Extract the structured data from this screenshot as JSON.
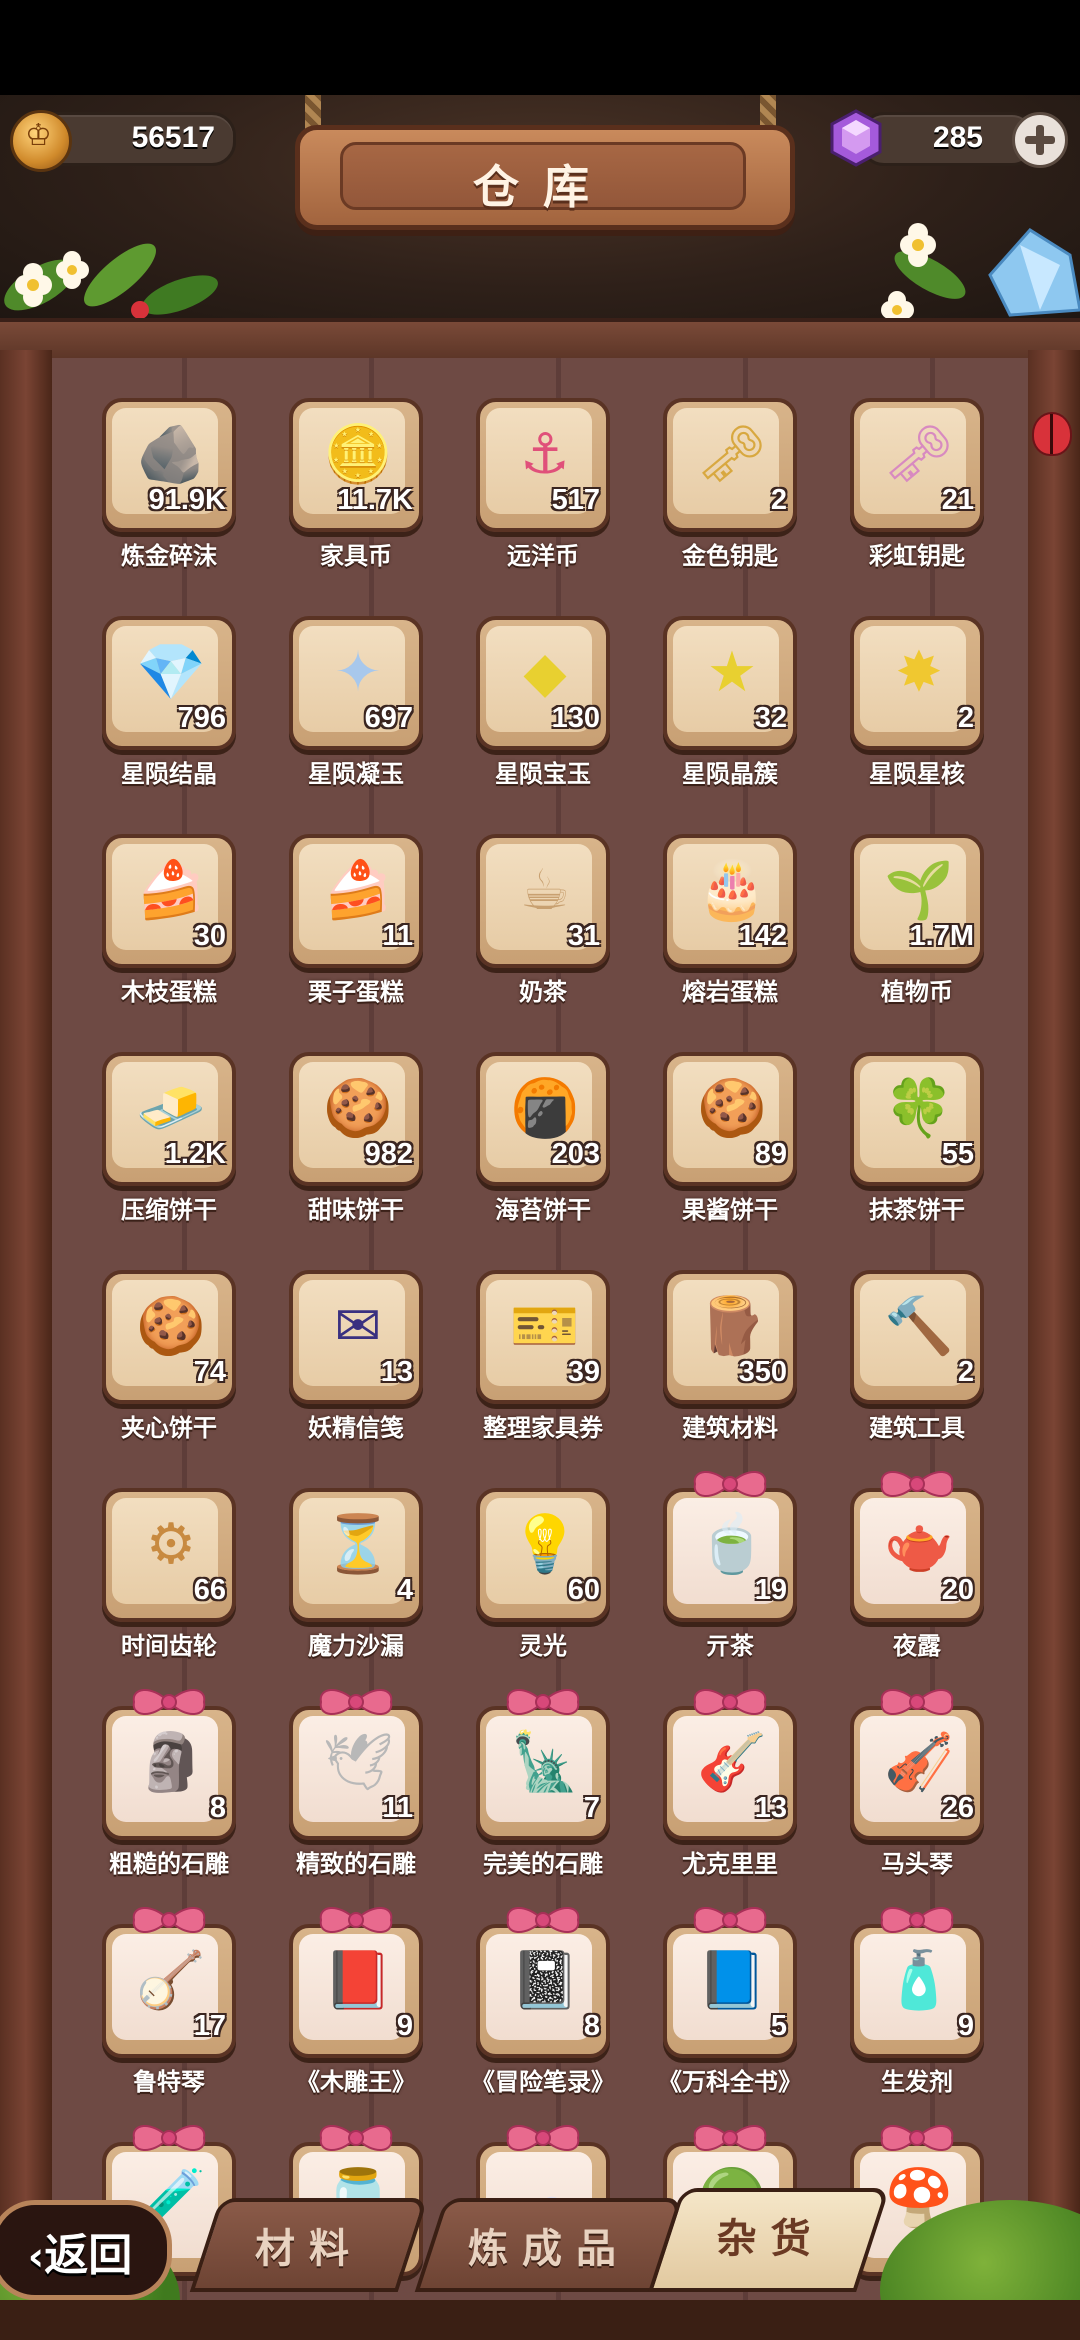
{
  "header": {
    "title": "仓库",
    "coins": "56517",
    "gems": "285"
  },
  "icons": {
    "coin": "coin-icon",
    "gem": "purple-gem-icon",
    "add": "plus-icon"
  },
  "items": [
    {
      "name": "炼金碎沫",
      "count": "91.9K",
      "icon": "🪨",
      "bg": "#8a6a4a",
      "gift": false
    },
    {
      "name": "家具币",
      "count": "11.7K",
      "icon": "🪙",
      "bg": "#8aa0c4",
      "gift": false
    },
    {
      "name": "远洋币",
      "count": "517",
      "icon": "⚓",
      "bg": "#e0507a",
      "gift": false
    },
    {
      "name": "金色钥匙",
      "count": "2",
      "icon": "🗝",
      "bg": "#d8a840",
      "gift": false
    },
    {
      "name": "彩虹钥匙",
      "count": "21",
      "icon": "🗝",
      "bg": "#d88ac0",
      "gift": false
    },
    {
      "name": "星陨结晶",
      "count": "796",
      "icon": "💎",
      "bg": "#9ab6e0",
      "gift": false
    },
    {
      "name": "星陨凝玉",
      "count": "697",
      "icon": "✦",
      "bg": "#a8c8ec",
      "gift": false
    },
    {
      "name": "星陨宝玉",
      "count": "130",
      "icon": "◆",
      "bg": "#e8d030",
      "gift": false
    },
    {
      "name": "星陨晶簇",
      "count": "32",
      "icon": "★",
      "bg": "#e8d030",
      "gift": false
    },
    {
      "name": "星陨星核",
      "count": "2",
      "icon": "✸",
      "bg": "#f0c830",
      "gift": false
    },
    {
      "name": "木枝蛋糕",
      "count": "30",
      "icon": "🍰",
      "bg": "#7a5030",
      "gift": false
    },
    {
      "name": "栗子蛋糕",
      "count": "11",
      "icon": "🍰",
      "bg": "#a86a40",
      "gift": false
    },
    {
      "name": "奶茶",
      "count": "31",
      "icon": "☕",
      "bg": "#c8a070",
      "gift": false
    },
    {
      "name": "熔岩蛋糕",
      "count": "142",
      "icon": "🎂",
      "bg": "#c83030",
      "gift": false
    },
    {
      "name": "植物币",
      "count": "1.7M",
      "icon": "🌱",
      "bg": "#3aa860",
      "gift": false
    },
    {
      "name": "压缩饼干",
      "count": "1.2K",
      "icon": "🧈",
      "bg": "#e8c890",
      "gift": false
    },
    {
      "name": "甜味饼干",
      "count": "982",
      "icon": "🍪",
      "bg": "#e0a850",
      "gift": false
    },
    {
      "name": "海苔饼干",
      "count": "203",
      "icon": "🍘",
      "bg": "#e08a30",
      "gift": false
    },
    {
      "name": "果酱饼干",
      "count": "89",
      "icon": "🍪",
      "bg": "#e8a040",
      "gift": false
    },
    {
      "name": "抹茶饼干",
      "count": "55",
      "icon": "🍀",
      "bg": "#60b040",
      "gift": false
    },
    {
      "name": "夹心饼干",
      "count": "74",
      "icon": "🍪",
      "bg": "#e06090",
      "gift": false
    },
    {
      "name": "妖精信笺",
      "count": "13",
      "icon": "✉",
      "bg": "#3a3080",
      "gift": false
    },
    {
      "name": "整理家具券",
      "count": "39",
      "icon": "🎫",
      "bg": "#3a3a80",
      "gift": false
    },
    {
      "name": "建筑材料",
      "count": "350",
      "icon": "🪵",
      "bg": "#8a5a38",
      "gift": false
    },
    {
      "name": "建筑工具",
      "count": "2",
      "icon": "🔨",
      "bg": "#7a6a60",
      "gift": false
    },
    {
      "name": "时间齿轮",
      "count": "66",
      "icon": "⚙",
      "bg": "#c88a40",
      "gift": false
    },
    {
      "name": "魔力沙漏",
      "count": "4",
      "icon": "⏳",
      "bg": "#a07040",
      "gift": false
    },
    {
      "name": "灵光",
      "count": "60",
      "icon": "💡",
      "bg": "#3a7aa8",
      "gift": false
    },
    {
      "name": "亓茶",
      "count": "19",
      "icon": "🍵",
      "bg": "#90c060",
      "gift": true
    },
    {
      "name": "夜露",
      "count": "20",
      "icon": "🫖",
      "bg": "#60b8e0",
      "gift": true
    },
    {
      "name": "粗糙的石雕",
      "count": "8",
      "icon": "🗿",
      "bg": "#b0b0b0",
      "gift": true
    },
    {
      "name": "精致的石雕",
      "count": "11",
      "icon": "🕊",
      "bg": "#b8b8b8",
      "gift": true
    },
    {
      "name": "完美的石雕",
      "count": "7",
      "icon": "🗽",
      "bg": "#a8a8a8",
      "gift": true
    },
    {
      "name": "尤克里里",
      "count": "13",
      "icon": "🎸",
      "bg": "#a86a30",
      "gift": true
    },
    {
      "name": "马头琴",
      "count": "26",
      "icon": "🎻",
      "bg": "#c03030",
      "gift": true
    },
    {
      "name": "鲁特琴",
      "count": "17",
      "icon": "🪕",
      "bg": "#b08040",
      "gift": true
    },
    {
      "name": "《木雕王》",
      "count": "9",
      "icon": "📕",
      "bg": "#8a4a20",
      "gift": true
    },
    {
      "name": "《冒险笔录》",
      "count": "8",
      "icon": "📓",
      "bg": "#303030",
      "gift": true
    },
    {
      "name": "《万科全书》",
      "count": "5",
      "icon": "📘",
      "bg": "#b03a40",
      "gift": true
    },
    {
      "name": "生发剂",
      "count": "9",
      "icon": "🧴",
      "bg": "#e8e0a0",
      "gift": true
    },
    {
      "name": "",
      "count": "",
      "icon": "🧪",
      "bg": "#9060c0",
      "gift": true
    },
    {
      "name": "",
      "count": "",
      "icon": "🫙",
      "bg": "#a0c0e0",
      "gift": true
    },
    {
      "name": "",
      "count": "",
      "icon": "☁",
      "bg": "#e0e0f0",
      "gift": true
    },
    {
      "name": "",
      "count": "",
      "icon": "🟢",
      "bg": "#a0d040",
      "gift": true
    },
    {
      "name": "",
      "count": "",
      "icon": "🍄",
      "bg": "#d04040",
      "gift": true
    }
  ],
  "tabs": [
    {
      "label": "材料",
      "active": false
    },
    {
      "label": "炼成品",
      "active": false
    },
    {
      "label": "杂货",
      "active": true
    }
  ],
  "back_label": "返回"
}
